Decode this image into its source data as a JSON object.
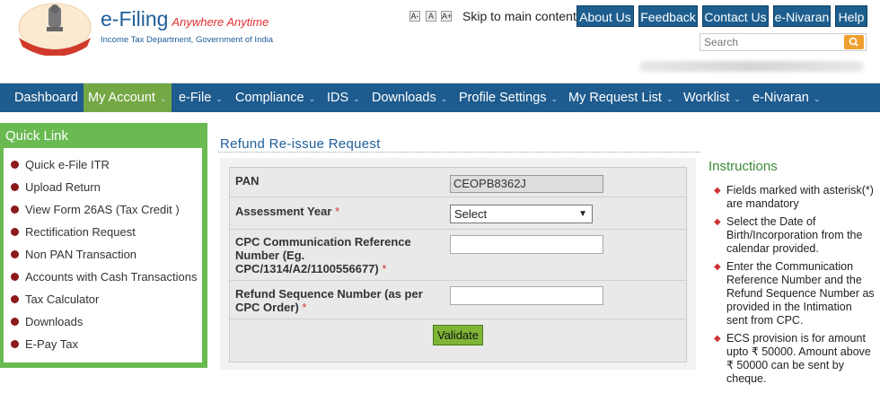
{
  "header": {
    "brand_title": "e-Filing",
    "brand_tagline": "Anywhere Anytime",
    "brand_subtitle": "Income Tax Department, Government of India",
    "font_buttons": [
      "A-",
      "A",
      "A+"
    ],
    "skip_link": "Skip to main content",
    "top_buttons": [
      "About Us",
      "Feedback",
      "Contact Us",
      "e-Nivaran",
      "Help"
    ],
    "search_placeholder": "Search"
  },
  "nav": {
    "items": [
      "Dashboard",
      "My Account",
      "e-File",
      "Compliance",
      "IDS",
      "Downloads",
      "Profile Settings",
      "My Request List",
      "Worklist",
      "e-Nivaran"
    ],
    "active": "My Account"
  },
  "quick_link": {
    "title": "Quick Link",
    "items": [
      "Quick e-File ITR",
      "Upload Return",
      "View Form 26AS (Tax Credit )",
      "Rectification Request",
      "Non PAN Transaction",
      "Accounts with Cash Transactions",
      "Tax Calculator",
      "Downloads",
      "E-Pay Tax"
    ]
  },
  "form": {
    "title": "Refund Re-issue Request",
    "pan_label": "PAN",
    "pan_value": "CEOPB8362J",
    "ay_label": "Assessment Year",
    "ay_selected": "Select",
    "cpc_label_1": "CPC Communication Reference",
    "cpc_label_2": "Number (Eg.",
    "cpc_label_3": "CPC/1314/A2/1100556677)",
    "refund_label_1": "Refund Sequence Number (as per",
    "refund_label_2": "CPC Order)",
    "required_mark": "*",
    "validate_button": "Validate"
  },
  "instructions": {
    "title": "Instructions",
    "items": [
      {
        "lines": [
          "Fields marked with asterisk(*)",
          "are mandatory"
        ]
      },
      {
        "lines": [
          "Select the Date of",
          "Birth/Incorporation from the",
          "calendar provided."
        ]
      },
      {
        "lines": [
          "Enter the Communication",
          "Reference Number and the",
          "Refund Sequence Number as",
          "provided in the Intimation",
          "sent from CPC."
        ]
      },
      {
        "lines": [
          "ECS provision is for amount",
          "upto ₹ 50000. Amount above",
          "₹ 50000 can be sent by",
          "cheque."
        ]
      }
    ]
  },
  "colors": {
    "nav_bg": "#1e5b8e",
    "nav_active": "#74a845",
    "quicklink_bg": "#6aba52",
    "brand_blue": "#1d5e9a",
    "accent_red": "#e03030"
  }
}
